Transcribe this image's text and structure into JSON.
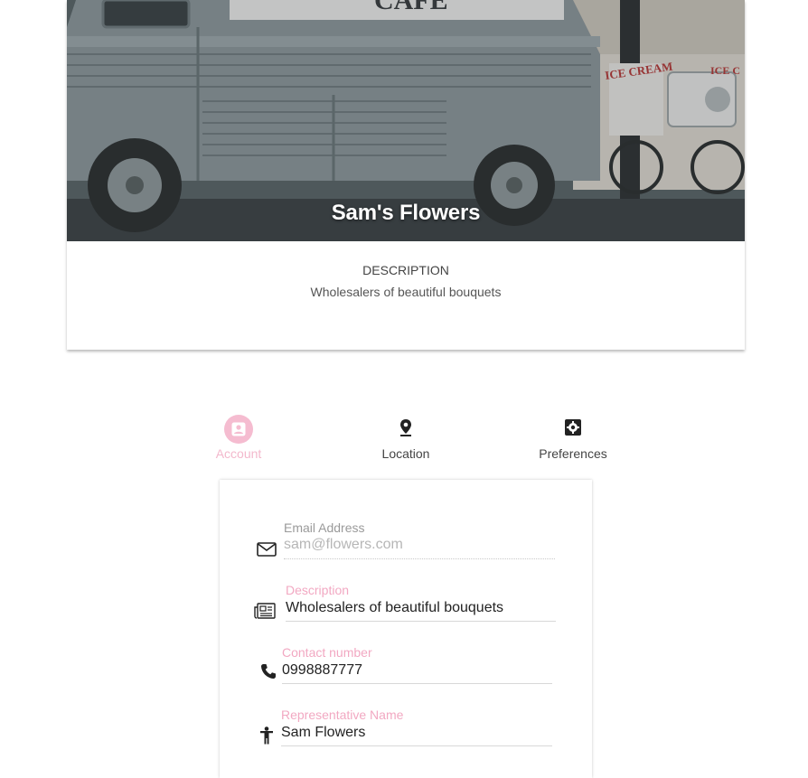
{
  "hero": {
    "title": "Sam's Flowers",
    "sign_text": "CAFE",
    "ice_cream_sign": "ICE CREAM",
    "ice_cream_sign_2": "ICE C"
  },
  "description": {
    "heading": "DESCRIPTION",
    "text": "Wholesalers of beautiful bouquets"
  },
  "tabs": [
    {
      "label": "Account",
      "icon": "account-box-icon",
      "active": true
    },
    {
      "label": "Location",
      "icon": "map-pin-icon",
      "active": false
    },
    {
      "label": "Preferences",
      "icon": "settings-box-icon",
      "active": false
    }
  ],
  "form": {
    "email": {
      "label": "Email Address",
      "value": "sam@flowers.com",
      "icon": "envelope-icon"
    },
    "description": {
      "label": "Description",
      "value": "Wholesalers of beautiful bouquets",
      "icon": "newspaper-icon"
    },
    "contact": {
      "label": "Contact number",
      "value": "0998887777",
      "icon": "phone-icon"
    },
    "representative": {
      "label": "Representative Name",
      "value": "Sam Flowers",
      "icon": "person-icon"
    }
  },
  "colors": {
    "accent": "#f5bcd0",
    "label_pink": "#f2a8c2"
  }
}
